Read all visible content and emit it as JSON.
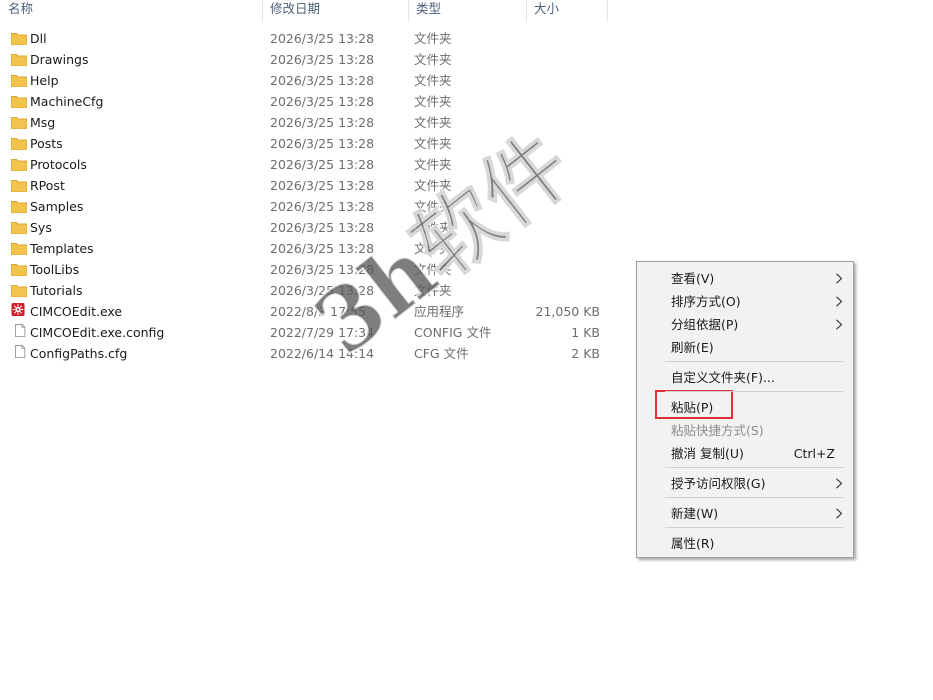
{
  "header": {
    "col_name": "名称",
    "col_date": "修改日期",
    "col_type": "类型",
    "col_size": "大小"
  },
  "files": [
    {
      "name": "Dll",
      "date": "2026/3/25 13:28",
      "type": "文件夹",
      "size": "",
      "icon": "folder-icon"
    },
    {
      "name": "Drawings",
      "date": "2026/3/25 13:28",
      "type": "文件夹",
      "size": "",
      "icon": "folder-icon"
    },
    {
      "name": "Help",
      "date": "2026/3/25 13:28",
      "type": "文件夹",
      "size": "",
      "icon": "folder-icon"
    },
    {
      "name": "MachineCfg",
      "date": "2026/3/25 13:28",
      "type": "文件夹",
      "size": "",
      "icon": "folder-icon"
    },
    {
      "name": "Msg",
      "date": "2026/3/25 13:28",
      "type": "文件夹",
      "size": "",
      "icon": "folder-icon"
    },
    {
      "name": "Posts",
      "date": "2026/3/25 13:28",
      "type": "文件夹",
      "size": "",
      "icon": "folder-icon"
    },
    {
      "name": "Protocols",
      "date": "2026/3/25 13:28",
      "type": "文件夹",
      "size": "",
      "icon": "folder-icon"
    },
    {
      "name": "RPost",
      "date": "2026/3/25 13:28",
      "type": "文件夹",
      "size": "",
      "icon": "folder-icon"
    },
    {
      "name": "Samples",
      "date": "2026/3/25 13:28",
      "type": "文件夹",
      "size": "",
      "icon": "folder-icon"
    },
    {
      "name": "Sys",
      "date": "2026/3/25 13:28",
      "type": "文件夹",
      "size": "",
      "icon": "folder-icon"
    },
    {
      "name": "Templates",
      "date": "2026/3/25 13:28",
      "type": "文件夹",
      "size": "",
      "icon": "folder-icon"
    },
    {
      "name": "ToolLibs",
      "date": "2026/3/25 13:28",
      "type": "文件夹",
      "size": "",
      "icon": "folder-icon"
    },
    {
      "name": "Tutorials",
      "date": "2026/3/25 13:28",
      "type": "文件夹",
      "size": "",
      "icon": "folder-icon"
    },
    {
      "name": "CIMCOEdit.exe",
      "date": "2022/8/3 17:55",
      "type": "应用程序",
      "size": "21,050 KB",
      "icon": "cimco-app-icon"
    },
    {
      "name": "CIMCOEdit.exe.config",
      "date": "2022/7/29 17:34",
      "type": "CONFIG 文件",
      "size": "1 KB",
      "icon": "file-icon"
    },
    {
      "name": "ConfigPaths.cfg",
      "date": "2022/6/14 14:14",
      "type": "CFG 文件",
      "size": "2 KB",
      "icon": "file-icon"
    }
  ],
  "context_menu": {
    "items": [
      {
        "label": "查看(V)",
        "submenu": true,
        "enabled": true
      },
      {
        "label": "排序方式(O)",
        "submenu": true,
        "enabled": true
      },
      {
        "label": "分组依据(P)",
        "submenu": true,
        "enabled": true
      },
      {
        "label": "刷新(E)",
        "submenu": false,
        "enabled": true
      },
      {
        "label": "自定义文件夹(F)...",
        "submenu": false,
        "enabled": true
      },
      {
        "label": "粘贴(P)",
        "submenu": false,
        "enabled": true
      },
      {
        "label": "粘贴快捷方式(S)",
        "submenu": false,
        "enabled": false
      },
      {
        "label": "撤消 复制(U)",
        "shortcut": "Ctrl+Z",
        "submenu": false,
        "enabled": true
      },
      {
        "label": "授予访问权限(G)",
        "submenu": true,
        "enabled": true
      },
      {
        "label": "新建(W)",
        "submenu": true,
        "enabled": true
      },
      {
        "label": "属性(R)",
        "submenu": false,
        "enabled": true
      }
    ],
    "highlight_color": "#e0303a"
  },
  "watermark": "3h软件",
  "colors": {
    "folder": "#f3c44c",
    "folder_dark": "#dca92f",
    "cimco_red": "#d0202a"
  }
}
